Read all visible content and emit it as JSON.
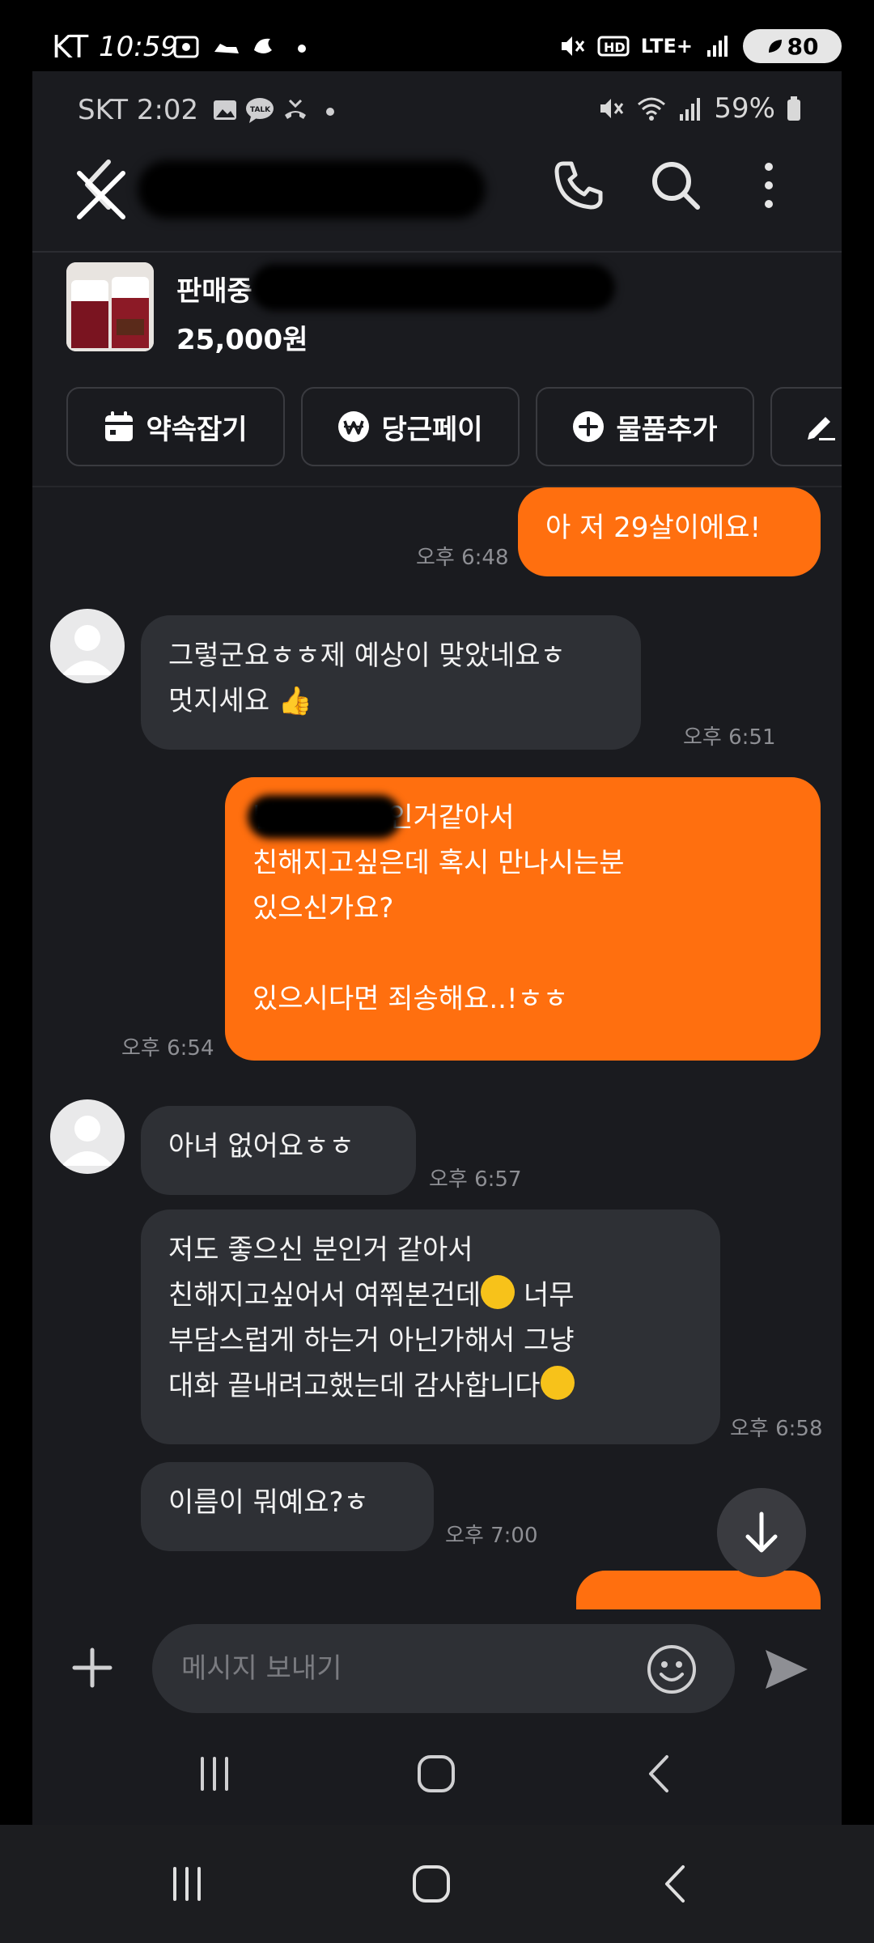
{
  "outer_status": {
    "carrier": "KT",
    "time": "10:59",
    "battery": "80",
    "network": "LTE+"
  },
  "inner_status": {
    "time": "SKT 2:02",
    "talk_badge": "TALK",
    "battery": "59%"
  },
  "product": {
    "status": "판매중",
    "price": "25,000원"
  },
  "actions": [
    {
      "label": "약속잡기",
      "icon": "calendar-icon"
    },
    {
      "label": "당근페이",
      "icon": "won-icon"
    },
    {
      "label": "물품추가",
      "icon": "plus-circle-icon"
    },
    {
      "label": "",
      "icon": "pencil-icon"
    }
  ],
  "messages": [
    {
      "sender": "me",
      "text": "아 저 29살이에요!",
      "time": "오후 6:48"
    },
    {
      "sender": "them",
      "text": "그렇군요ㅎㅎ제 예상이 맞았네요ㅎ\n멋지세요 👍",
      "time": "오후 6:51"
    },
    {
      "sender": "me",
      "text": "님 좋으신분인거같아서\n친해지고싶은데 혹시 만나시는분\n있으신가요?\n\n있으시다면 죄송해요..!ㅎㅎ",
      "time": "오후 6:54"
    },
    {
      "sender": "them",
      "text": "아녀 없어요ㅎㅎ",
      "time": "오후 6:57"
    },
    {
      "sender": "them",
      "text": "저도 좋으신 분인거 같아서\n친해지고싶어서 여쭤본건데",
      "text2": " 너무\n부담스럽게 하는거 아닌가해서 그냥\n대화 끝내려고했는데 감사합니다",
      "time": "오후 6:58"
    },
    {
      "sender": "them",
      "text": "이름이 뭐예요?ㅎ",
      "time": "오후 7:00"
    }
  ],
  "composer": {
    "placeholder": "메시지 보내기"
  },
  "colors": {
    "accent": "#ff6f0f",
    "bubble_other": "#2e3035",
    "background": "#1a1b1f"
  }
}
